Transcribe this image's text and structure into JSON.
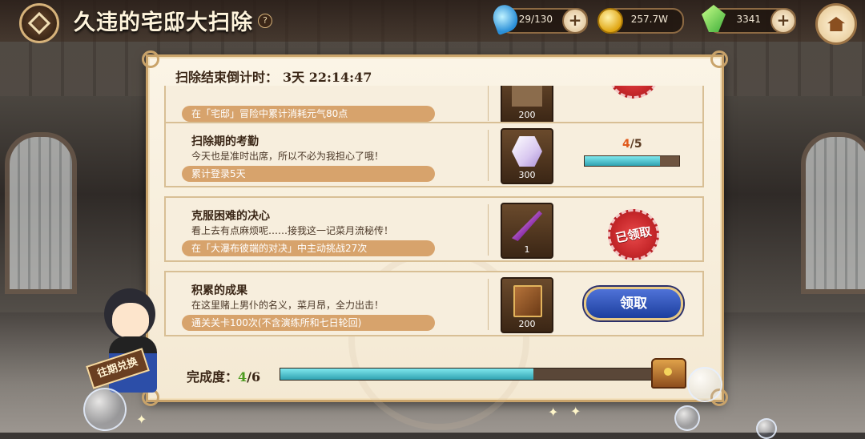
{
  "header": {
    "title": "久违的宅邸大扫除",
    "help_glyph": "?",
    "resources": [
      {
        "name": "energy",
        "icon": "energy-drop-icon",
        "value": "29/130"
      },
      {
        "name": "gold",
        "icon": "gold-coin-icon",
        "value": "257.7W"
      },
      {
        "name": "gem",
        "icon": "green-gem-icon",
        "value": "3341"
      }
    ],
    "plus_glyph": "+"
  },
  "panel": {
    "countdown_label": "扫除结束倒计时：",
    "countdown_value": "3天 22:14:47",
    "tasks": [
      {
        "title": "",
        "desc": "",
        "condition": "在「宅邸」冒险中累计消耗元气80点",
        "reward_qty": "200",
        "state": "claimed"
      },
      {
        "title": "扫除期的考勤",
        "desc": "今天也是准时出席，所以不必为我担心了哦！",
        "condition": "累计登录5天",
        "reward_qty": "300",
        "state": "in-progress",
        "progress_current": "4",
        "progress_total": "/5",
        "progress_fraction": 0.8
      },
      {
        "title": "克服困难的决心",
        "desc": "看上去有点麻烦呢……接我这一记菜月流秘传！",
        "condition": "在「大瀑布彼端的对决」中主动挑战27次",
        "reward_qty": "1",
        "state": "claimed",
        "stamp_label": "已领取"
      },
      {
        "title": "积累的成果",
        "desc": "在这里赌上男仆的名义，菜月昂，全力出击！",
        "condition": "通关关卡100次(不含演练所和七日轮回)",
        "reward_qty": "200",
        "state": "claimable",
        "button_label": "领取"
      }
    ],
    "completion_label": "完成度：",
    "completion_current": "4",
    "completion_total": "/6",
    "completion_fraction": 0.667
  },
  "character": {
    "sign_label": "往期兑换"
  },
  "colors": {
    "progress_fill": "#2fa2b1",
    "claim_button": "#1d3f9e",
    "stamp_red": "#c7282b",
    "panel_bg": "#f4e9d3"
  }
}
